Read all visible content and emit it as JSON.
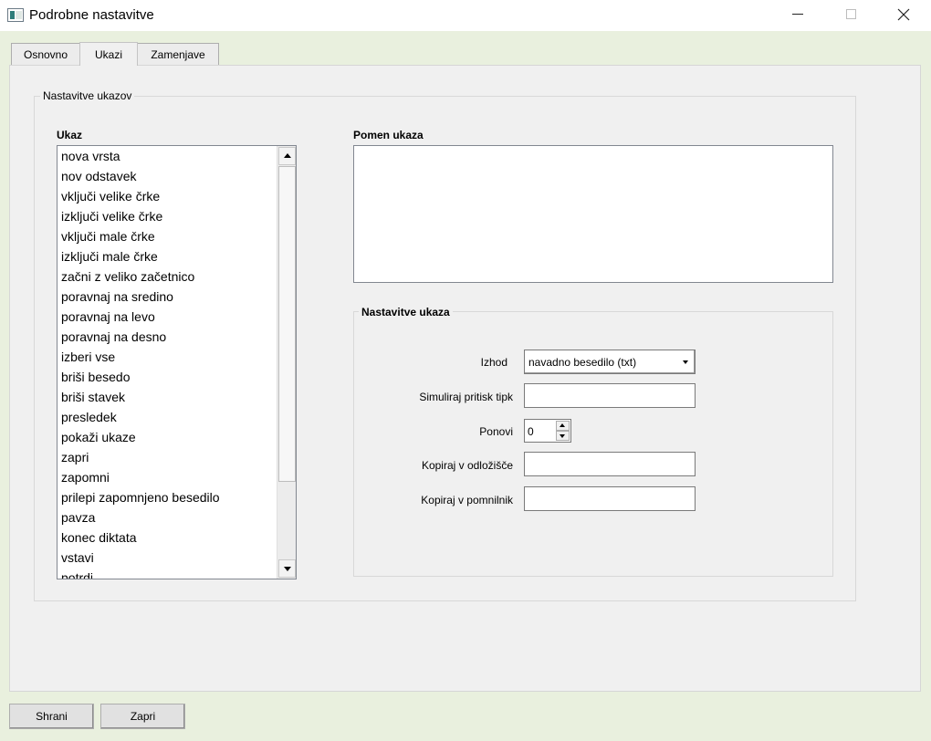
{
  "window": {
    "title": "Podrobne nastavitve"
  },
  "tabs": [
    {
      "label": "Osnovno",
      "active": false
    },
    {
      "label": "Ukazi",
      "active": true
    },
    {
      "label": "Zamenjave",
      "active": false
    }
  ],
  "commands_group": {
    "title": "Nastavitve ukazov",
    "list_header": "Ukaz",
    "list_items": [
      "nova vrsta",
      "nov odstavek",
      "vključi velike črke",
      "izključi velike črke",
      "vključi male črke",
      "izključi male črke",
      "začni z veliko začetnico",
      "poravnaj na sredino",
      "poravnaj na levo",
      "poravnaj na desno",
      "izberi vse",
      "briši besedo",
      "briši stavek",
      "presledek",
      "pokaži ukaze",
      "zapri",
      "zapomni",
      "prilepi zapomnjeno besedilo",
      "pavza",
      "konec diktata",
      "vstavi",
      "potrdi"
    ],
    "meaning_label": "Pomen ukaza",
    "meaning_text": ""
  },
  "command_settings": {
    "title": "Nastavitve ukaza",
    "output_label": "Izhod",
    "output_value": "navadno besedilo (txt)",
    "simulate_label": "Simuliraj pritisk tipk",
    "simulate_value": "",
    "repeat_label": "Ponovi",
    "repeat_value": "0",
    "clipboard_label": "Kopiraj v odložišče",
    "clipboard_value": "",
    "memory_label": "Kopiraj v pomnilnik",
    "memory_value": ""
  },
  "buttons": {
    "save": "Shrani",
    "close": "Zapri"
  },
  "icons": {
    "app": "app-window-icon",
    "minimize": "minimize-icon",
    "maximize": "maximize-icon",
    "close": "close-icon",
    "scroll_up": "scroll-up-arrow-icon",
    "scroll_down": "scroll-down-arrow-icon",
    "dropdown": "dropdown-arrow-icon"
  },
  "colors": {
    "window_background": "#e9f0de",
    "panel_background": "#f0f0f0"
  }
}
